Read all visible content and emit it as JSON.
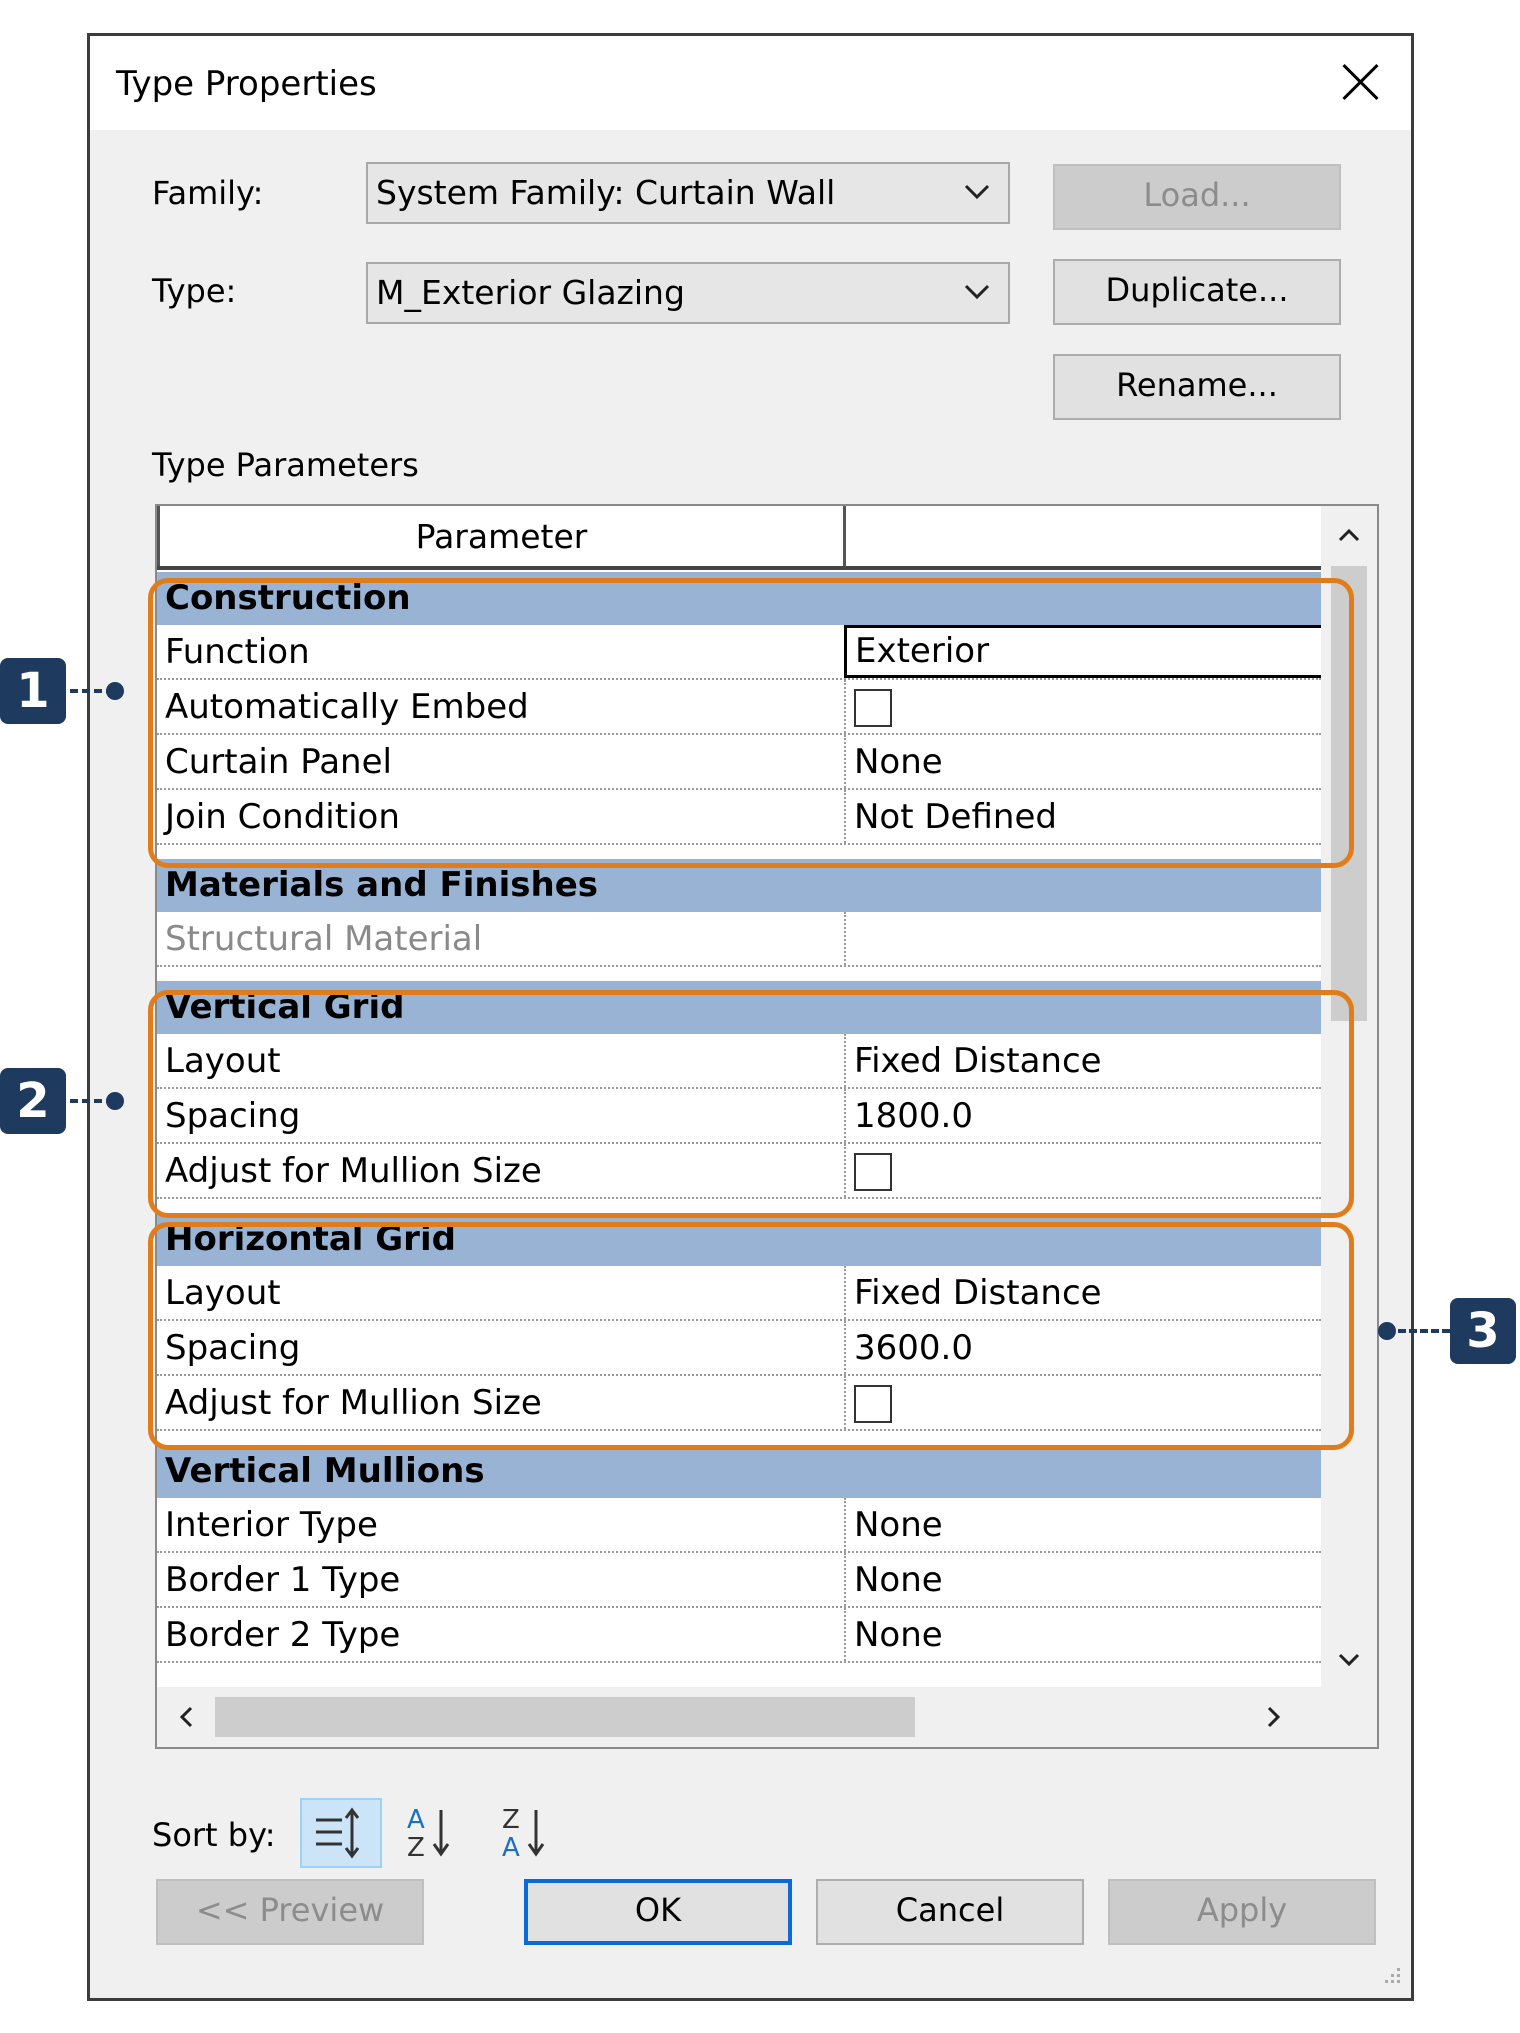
{
  "dialog": {
    "title": "Type Properties",
    "family_label": "Family:",
    "family_value": "System Family: Curtain Wall",
    "type_label": "Type:",
    "type_value": "M_Exterior Glazing",
    "load_button": "Load...",
    "duplicate_button": "Duplicate...",
    "rename_button": "Rename...",
    "type_parameters_label": "Type Parameters"
  },
  "grid": {
    "header": {
      "parameter": "Parameter",
      "value": ""
    },
    "groups": [
      {
        "name": "Construction",
        "rows": [
          {
            "name": "Function",
            "value": "Exterior"
          },
          {
            "name": "Automatically Embed",
            "checkbox": false
          },
          {
            "name": "Curtain Panel",
            "value": "None"
          },
          {
            "name": "Join Condition",
            "value": "Not Defined"
          }
        ]
      },
      {
        "name": "Materials and Finishes",
        "rows": [
          {
            "name": "Structural Material",
            "value": ""
          }
        ]
      },
      {
        "name": "Vertical Grid",
        "rows": [
          {
            "name": "Layout",
            "value": "Fixed Distance"
          },
          {
            "name": "Spacing",
            "value": "1800.0"
          },
          {
            "name": "Adjust for Mullion Size",
            "checkbox": false
          }
        ]
      },
      {
        "name": "Horizontal Grid",
        "rows": [
          {
            "name": "Layout",
            "value": "Fixed Distance"
          },
          {
            "name": "Spacing",
            "value": "3600.0"
          },
          {
            "name": "Adjust for Mullion Size",
            "checkbox": false
          }
        ]
      },
      {
        "name": "Vertical Mullions",
        "rows": [
          {
            "name": "Interior Type",
            "value": "None"
          },
          {
            "name": "Border 1 Type",
            "value": "None"
          },
          {
            "name": "Border 2 Type",
            "value": "None"
          }
        ]
      }
    ]
  },
  "sort": {
    "label": "Sort by:"
  },
  "footer": {
    "preview": "<< Preview",
    "ok": "OK",
    "cancel": "Cancel",
    "apply": "Apply"
  },
  "callouts": [
    "1",
    "2",
    "3"
  ],
  "colors": {
    "group_header": "#99b3d4",
    "callout_border": "#e07d1a",
    "badge": "#1e3a5f",
    "default_button_border": "#0a6ad8"
  }
}
